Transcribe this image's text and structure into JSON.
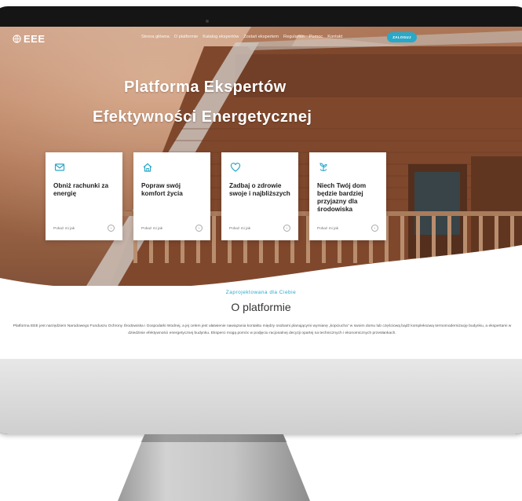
{
  "nav": {
    "logo_text": "EEE",
    "logo_sub": "",
    "items": [
      "Strona główna",
      "O platformie",
      "Katalog ekspertów",
      "Zostań ekspertem",
      "Regulamin",
      "Pomoc",
      "Kontakt"
    ],
    "login_label": "ZALOGUJ"
  },
  "hero": {
    "title_line1": "Platforma Ekspertów",
    "title_line2": "Efektywności Energetycznej"
  },
  "cards": [
    {
      "title": "Obniż rachunki za energię",
      "link": "Pokaż mi jak",
      "icon": "mail-icon"
    },
    {
      "title": "Popraw swój komfort życia",
      "link": "Pokaż mi jak",
      "icon": "home-icon"
    },
    {
      "title": "Zadbaj o zdrowie swoje i najbliższych",
      "link": "Pokaż mi jak",
      "icon": "heart-icon"
    },
    {
      "title": "Niech Twój dom będzie bardziej przyjazny dla środowiska",
      "link": "Pokaż mi jak",
      "icon": "plant-icon"
    }
  ],
  "about": {
    "kicker": "Zaprojektowana dla Ciebie",
    "title": "O platformie",
    "text": "Platforma EEE jest narzędziem Narodowego Funduszu Ochrony Środowiska i Gospodarki Wodnej, a jej celem jest ułatwienie nawiązania kontaktu między osobami planującymi wymianę „kopciucha” w swoim domu lub częściową bądź kompleksową termomodernizację budynku, a ekspertami w dziedzinie efektywności energetycznej budynku. Eksperci mogą pomóc w podjęciu racjonalnej decyzji opartej na technicznych i ekonomicznych przesłankach."
  },
  "colors": {
    "accent": "#2aa8c8",
    "card_bg": "#ffffff",
    "hero_wood": "#8f5a3e"
  }
}
